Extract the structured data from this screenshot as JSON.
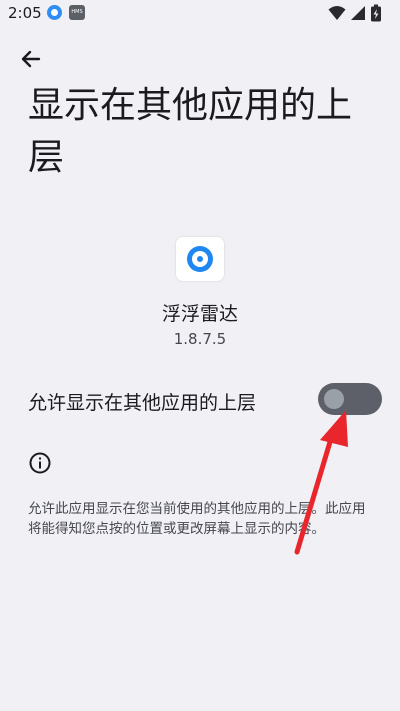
{
  "status_bar": {
    "time": "2:05",
    "hms_label": "HMS",
    "app_icon": "app-notification-icon",
    "icons": [
      "wifi-icon",
      "signal-icon",
      "battery-icon"
    ]
  },
  "header": {
    "back_icon": "arrow-left-icon",
    "title": "显示在其他应用的上层"
  },
  "app": {
    "name": "浮浮雷达",
    "version": "1.8.7.5",
    "icon": "app-icon"
  },
  "permission": {
    "label": "允许显示在其他应用的上层",
    "enabled": false
  },
  "info": {
    "icon": "info-icon",
    "description": "允许此应用显示在您当前使用的其他应用的上层。此应用将能得知您点按的位置或更改屏幕上显示的内容。"
  },
  "annotation": {
    "arrow_color": "#e8262b",
    "arrow_icon": "red-arrow-annotation"
  },
  "colors": {
    "background": "#f1f1f5",
    "toggle_track": "#5d6068",
    "toggle_knob": "#9aa0a8",
    "accent_blue": "#1e88f0"
  }
}
